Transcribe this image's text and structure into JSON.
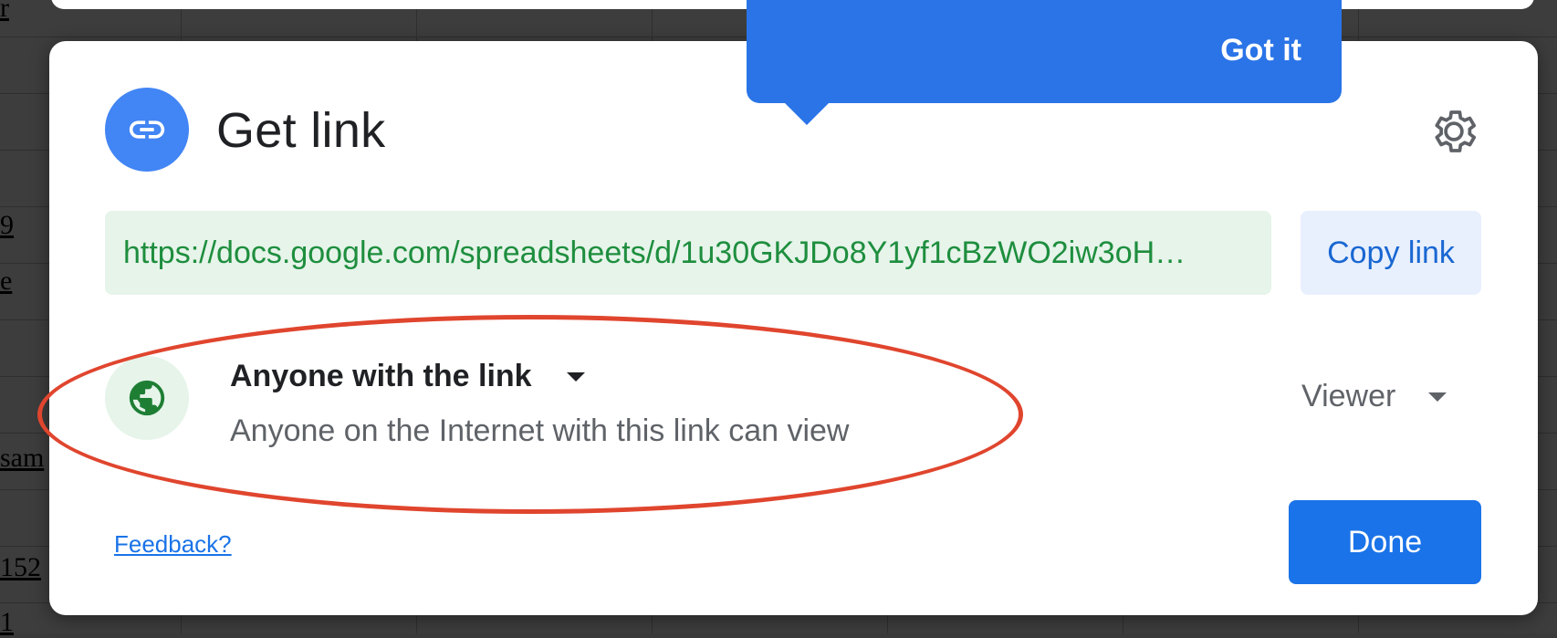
{
  "background": {
    "fragments": [
      "r",
      "9",
      "e",
      "sam",
      "152",
      "1"
    ]
  },
  "dialog": {
    "title": "Get link",
    "url": "https://docs.google.com/spreadsheets/d/1u30GKJDo8Y1yf1cBzWO2iw3oH…",
    "copy_label": "Copy link",
    "access": {
      "label": "Anyone with the link",
      "description": "Anyone on the Internet with this link can view",
      "role": "Viewer"
    },
    "feedback_label": "Feedback?",
    "done_label": "Done"
  },
  "tooltip": {
    "dismiss_label": "Got it"
  },
  "colors": {
    "primary": "#1a73e8",
    "link_icon_bg": "#4285f4",
    "url_bg": "#e6f4ea",
    "url_text": "#1e8e3e",
    "annotation": "#e0452e"
  },
  "icons": [
    "link-icon",
    "gear-icon",
    "globe-icon",
    "chevron-down-icon"
  ]
}
